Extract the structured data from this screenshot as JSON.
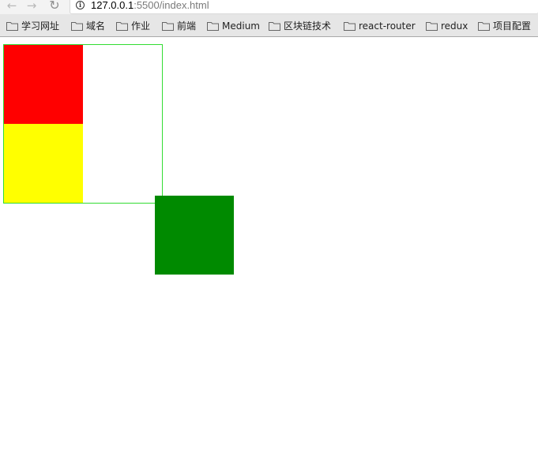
{
  "browser": {
    "url_host": "127.0.0.1",
    "url_rest": ":5500/index.html",
    "nav": {
      "back_icon": "arrow-left-icon",
      "forward_icon": "arrow-right-icon",
      "reload_icon": "reload-icon",
      "info_icon": "info-icon"
    }
  },
  "bookmarks": [
    {
      "label": "学习网址",
      "icon": "folder-icon"
    },
    {
      "label": "域名",
      "icon": "folder-icon"
    },
    {
      "label": "作业",
      "icon": "folder-icon"
    },
    {
      "label": "前端",
      "icon": "folder-icon"
    },
    {
      "label": "Medium",
      "icon": "folder-icon"
    },
    {
      "label": "区块链技术",
      "icon": "folder-icon"
    },
    {
      "label": "react-router",
      "icon": "folder-icon"
    },
    {
      "label": "redux",
      "icon": "folder-icon"
    },
    {
      "label": "项目配置",
      "icon": "folder-icon"
    }
  ],
  "page": {
    "colors": {
      "container_border": "#32dc32",
      "red_box": "#ff0000",
      "yellow_box": "#ffff00",
      "green_box": "#008a00"
    }
  }
}
